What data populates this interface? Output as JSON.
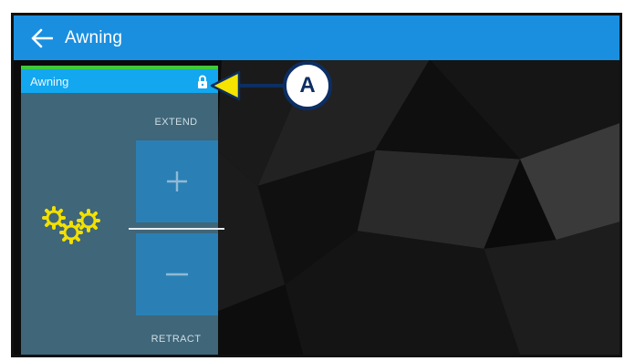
{
  "header": {
    "title": "Awning",
    "back_icon": "arrow-left-icon"
  },
  "panel": {
    "title": "Awning",
    "lock_icon": "lock-icon",
    "extend_label": "EXTEND",
    "retract_label": "RETRACT",
    "extend_icon": "plus-icon",
    "retract_icon": "minus-icon",
    "status_icon": "gears-icon"
  },
  "callout": {
    "letter": "A"
  },
  "colors": {
    "topbar": "#1a8fe0",
    "panel_header": "#12a7ef",
    "panel_strip": "#3ecb3a",
    "panel_body": "#3f6679",
    "button": "#2a80b4",
    "gears": "#f2e000",
    "callout_arrow": "#f5e400",
    "callout_border": "#0c2e63"
  }
}
